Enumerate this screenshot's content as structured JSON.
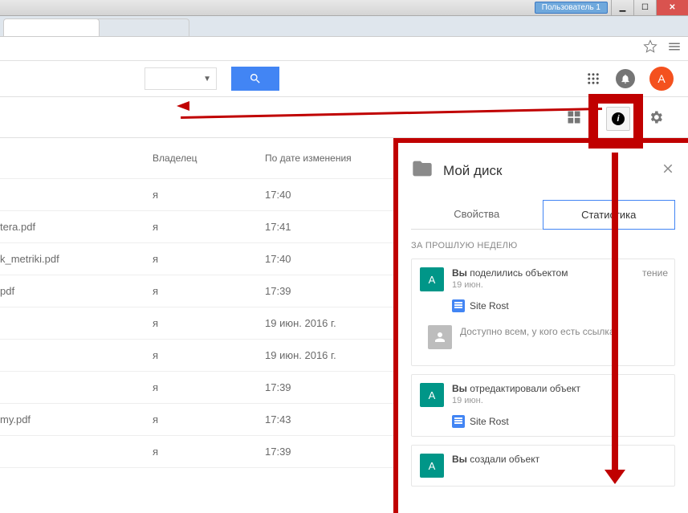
{
  "window": {
    "user_chip": "Пользователь 1"
  },
  "google_bar": {
    "avatar_initial": "А"
  },
  "table": {
    "headers": {
      "owner": "Владелец",
      "date": "По дате изменения"
    },
    "rows": [
      {
        "name": "",
        "owner": "я",
        "date": "17:40"
      },
      {
        "name": "tera.pdf",
        "owner": "я",
        "date": "17:41"
      },
      {
        "name": "k_metriki.pdf",
        "owner": "я",
        "date": "17:40"
      },
      {
        "name": "pdf",
        "owner": "я",
        "date": "17:39"
      },
      {
        "name": "",
        "owner": "я",
        "date": "19 июн. 2016 г."
      },
      {
        "name": "",
        "owner": "я",
        "date": "19 июн. 2016 г."
      },
      {
        "name": "",
        "owner": "я",
        "date": "17:39"
      },
      {
        "name": "my.pdf",
        "owner": "я",
        "date": "17:43"
      },
      {
        "name": "",
        "owner": "я",
        "date": "17:39"
      }
    ]
  },
  "panel": {
    "title": "Мой диск",
    "tabs": {
      "properties": "Свойства",
      "activity": "Статистика"
    },
    "section_label": "ЗА ПРОШЛУЮ НЕДЕЛЮ",
    "share_text": "Доступно всем, у кого есть ссылка",
    "items": [
      {
        "initial": "А",
        "you": "Вы",
        "action": "поделились объектом",
        "date": "19 июн.",
        "file": "Site Rost",
        "extra": "тение"
      },
      {
        "initial": "А",
        "you": "Вы",
        "action": "отредактировали объект",
        "date": "19 июн.",
        "file": "Site Rost"
      },
      {
        "initial": "А",
        "you": "Вы",
        "action": "создали объект"
      }
    ]
  }
}
